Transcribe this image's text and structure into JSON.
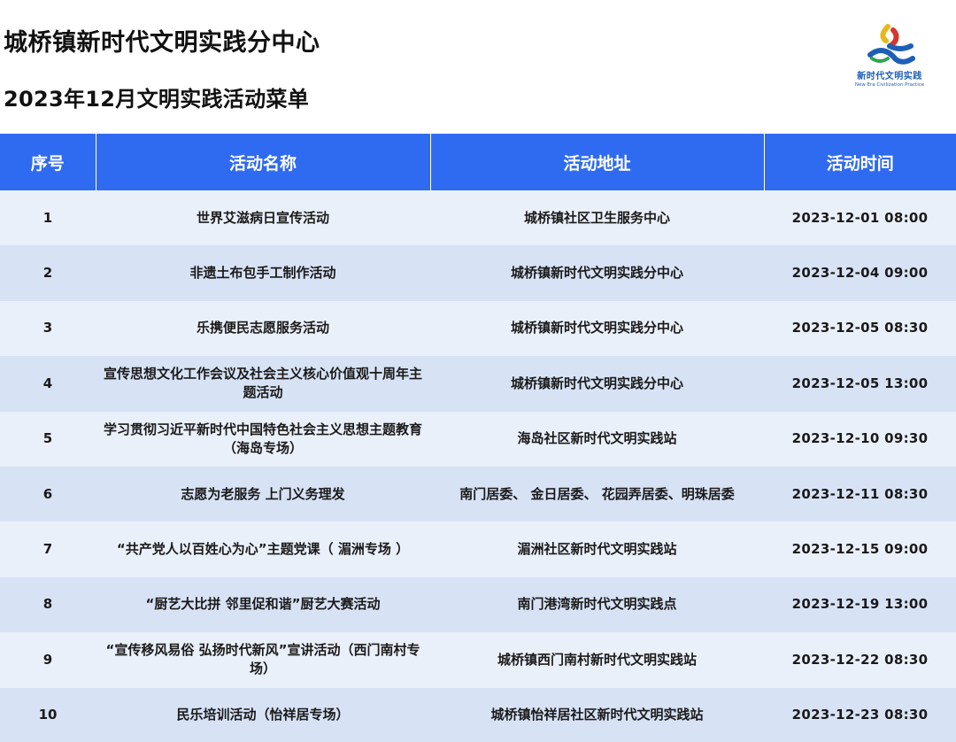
{
  "header": {
    "title": "城桥镇新时代文明实践分中心",
    "subtitle": "2023年12月文明实践活动菜单"
  },
  "logo": {
    "cn_text": "新时代文明实践",
    "en_text": "New Era Civilization Practice",
    "colors": [
      "#e8b81a",
      "#d9342b",
      "#2ea44f",
      "#1d5fb7"
    ]
  },
  "table": {
    "headers": [
      "序号",
      "活动名称",
      "活动地址",
      "活动时间"
    ],
    "header_color": "#2f6bf0",
    "row_colors": [
      "#eaf0fa",
      "#d7e2f5"
    ],
    "rows": [
      {
        "no": "1",
        "name": "世界艾滋病日宣传活动",
        "address": "城桥镇社区卫生服务中心",
        "time": "2023-12-01 08:00"
      },
      {
        "no": "2",
        "name": "非遗土布包手工制作活动",
        "address": "城桥镇新时代文明实践分中心",
        "time": "2023-12-04 09:00"
      },
      {
        "no": "3",
        "name": "乐携便民志愿服务活动",
        "address": "城桥镇新时代文明实践分中心",
        "time": "2023-12-05 08:30"
      },
      {
        "no": "4",
        "name": "宣传思想文化工作会议及社会主义核心价值观十周年主题活动",
        "address": "城桥镇新时代文明实践分中心",
        "time": "2023-12-05 13:00"
      },
      {
        "no": "5",
        "name": "学习贯彻习近平新时代中国特色社会主义思想主题教育（海岛专场）",
        "address": "海岛社区新时代文明实践站",
        "time": "2023-12-10 09:30"
      },
      {
        "no": "6",
        "name": "志愿为老服务 上门义务理发",
        "address": "南门居委、 金日居委、 花园弄居委、明珠居委",
        "time": "2023-12-11 08:30"
      },
      {
        "no": "7",
        "name": "“共产党人以百姓心为心”主题党课（ 湄洲专场 ）",
        "address": "湄洲社区新时代文明实践站",
        "time": "2023-12-15 09:00"
      },
      {
        "no": "8",
        "name": "“厨艺大比拼 邻里促和谐”厨艺大赛活动",
        "address": "南门港湾新时代文明实践点",
        "time": "2023-12-19 13:00"
      },
      {
        "no": "9",
        "name": "“宣传移风易俗 弘扬时代新风”宣讲活动（西门南村专场）",
        "address": "城桥镇西门南村新时代文明实践站",
        "time": "2023-12-22 08:30"
      },
      {
        "no": "10",
        "name": "民乐培训活动（怡祥居专场）",
        "address": "城桥镇怡祥居社区新时代文明实践站",
        "time": "2023-12-23 08:30"
      }
    ]
  }
}
